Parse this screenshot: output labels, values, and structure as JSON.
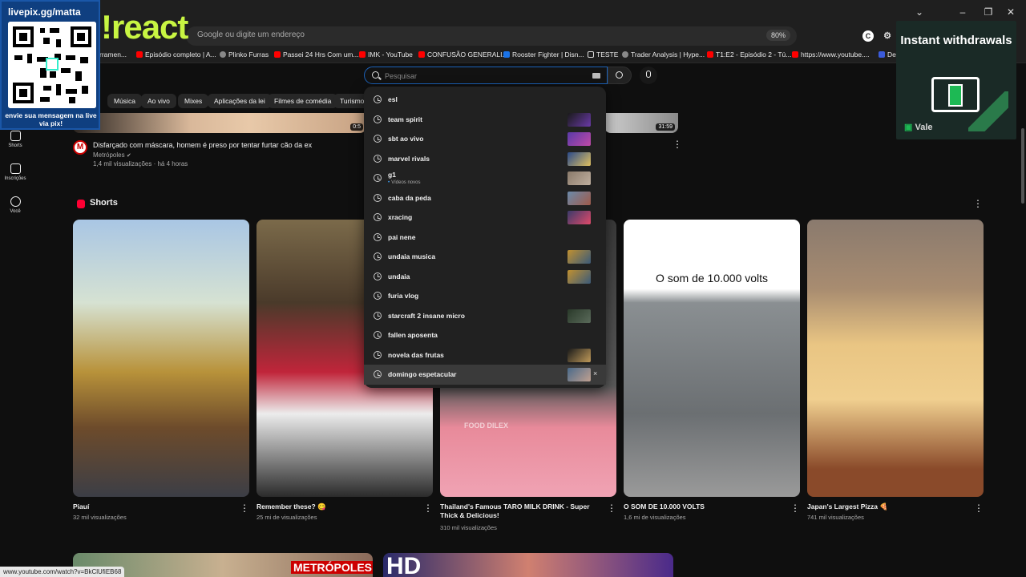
{
  "overlay": {
    "livepix_url": "livepix.gg/matta",
    "livepix_message": "envie sua mensagem na live via pix!",
    "react_label": "!react",
    "ad_headline": "Instant withdrawals",
    "ad_brand": "Vale"
  },
  "browser": {
    "address_placeholder": "Google ou digite um endereço",
    "zoom": "80%",
    "profile_letter": "C",
    "bookmarks": [
      "rramen...",
      "Episódio completo | A...",
      "Plinko Furras",
      "Passei 24 Hrs Com um...",
      "IMK - YouTube",
      "CONFUSÃO GENERALI...",
      "Rooster Fighter | Disn...",
      "TESTE",
      "Trader Analysis | Hype...",
      "T1:E2 - Episódio 2 - Tú...",
      "https://www.youtube....",
      "De"
    ],
    "status_url": "www.youtube.com/watch?v=BkClUfiEB68"
  },
  "guide": {
    "items": [
      {
        "label": "Shorts"
      },
      {
        "label": "Inscrições"
      },
      {
        "label": "Você"
      }
    ]
  },
  "chips": [
    "Música",
    "Ao vivo",
    "Mixes",
    "Aplicações da lei",
    "Filmes de comédia",
    "Turismo"
  ],
  "search": {
    "placeholder": "Pesquisar",
    "suggestions": [
      {
        "text": "esl"
      },
      {
        "text": "team spirit"
      },
      {
        "text": "sbt ao vivo"
      },
      {
        "text": "marvel rivals"
      },
      {
        "text": "g1",
        "sub": "Vídeos novos"
      },
      {
        "text": "caba da peda"
      },
      {
        "text": "xracing"
      },
      {
        "text": "pai nene"
      },
      {
        "text": "undaia musica"
      },
      {
        "text": "undaia"
      },
      {
        "text": "furia vlog"
      },
      {
        "text": "starcraft 2 insane micro"
      },
      {
        "text": "fallen aposenta"
      },
      {
        "text": "novela das frutas"
      },
      {
        "text": "domingo espetacular"
      }
    ],
    "remove_label": "×"
  },
  "top_video": {
    "title": "Disfarçado com máscara, homem é preso por tentar furtar cão da ex",
    "channel": "Metrópoles",
    "meta": "1,4 mil visualizações · há 4 horas",
    "duration_left": "0:5",
    "duration_right": "31:59",
    "avatar_letter": "M"
  },
  "shorts": {
    "section_title": "Shorts",
    "items": [
      {
        "title": "Piauí",
        "views": "32 mil visualizações"
      },
      {
        "title": "Remember these? 😋",
        "views": "25 mi de visualizações"
      },
      {
        "title": "Thailand's Famous TARO MILK DRINK - Super Thick & Delicious!",
        "views": "310 mil visualizações",
        "overlay": "FOOD DILEX"
      },
      {
        "title": "O SOM DE 10.000 VOLTS",
        "views": "1,6 mi de visualizações",
        "overlay": "O som de 10.000 volts"
      },
      {
        "title": "Japan's Largest Pizza 🍕",
        "views": "741 mil visualizações"
      }
    ]
  },
  "bottom_row": {
    "brand": "METRÓPOLES",
    "hd_label": "HD"
  }
}
